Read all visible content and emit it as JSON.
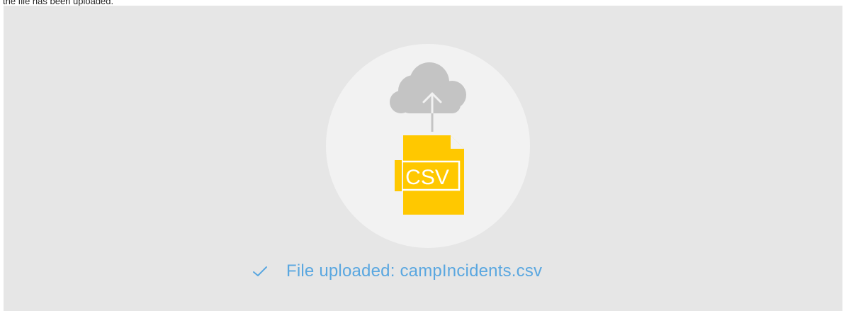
{
  "caption": "the file has been uploaded.",
  "upload_panel": {
    "icon": "csv-upload-icon",
    "file_label": "CSV",
    "status": {
      "icon": "checkmark-icon",
      "text": "File uploaded: campIncidents.csv"
    }
  },
  "colors": {
    "panel_bg": "#e6e6e6",
    "circle_bg": "#f2f2f2",
    "cloud": "#c4c4c4",
    "file": "#ffc800",
    "status_text": "#5aa7e0"
  }
}
